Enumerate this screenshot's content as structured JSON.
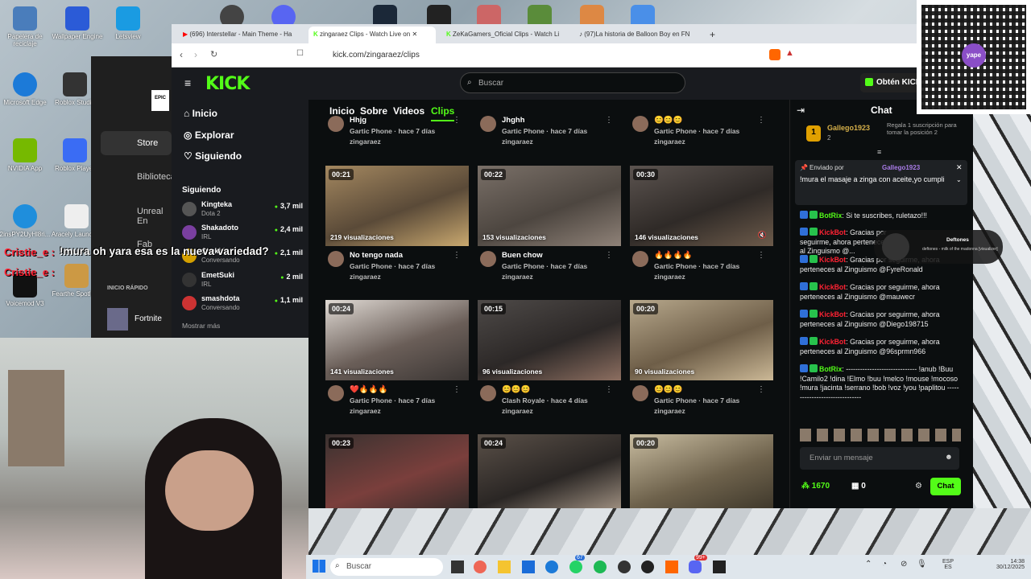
{
  "desktop": {
    "icons": [
      {
        "label": "Papelera de reciclaje",
        "color": "#4a7dbb"
      },
      {
        "label": "Wallpaper Engine",
        "color": "#2b5bd7"
      },
      {
        "label": "Letsview",
        "color": "#1a9be2"
      },
      {
        "label": "Microsoft Edge",
        "color": "#1c7ad8"
      },
      {
        "label": "Roblox Studio",
        "color": "#333"
      },
      {
        "label": "NVIDIA App",
        "color": "#76b900"
      },
      {
        "label": "Roblox Player",
        "color": "#3a6cf4"
      },
      {
        "label": "2insPY2UyHl8ri...",
        "color": "#1f8edc"
      },
      {
        "label": "Aracely Launcher",
        "color": "#eee"
      },
      {
        "label": "Voicemod V3",
        "color": "#111"
      },
      {
        "label": "Fearthe Spotlight",
        "color": "#c94"
      }
    ]
  },
  "overlay": {
    "chat_lines": [
      "Cristie_e :",
      "Cristie_e :"
    ],
    "chat_text": "!mura oh yara esa es la nueva variedad?"
  },
  "epic": {
    "items": [
      "Store",
      "Biblioteca",
      "Unreal En",
      "Fab"
    ],
    "quick": "INICIO RÁPIDO",
    "fortnite": "Fortnite"
  },
  "browser": {
    "tabs": [
      "(696) Interstellar - Main Theme - Ha",
      "zingaraez Clips - Watch Live on",
      "ZeKaGamers_Oficial Clips - Watch Li",
      "(97)La historia de Balloon Boy en FN"
    ],
    "url": "kick.com/zingaraez/clips"
  },
  "kick": {
    "logo": "KICK",
    "search_placeholder": "Buscar",
    "get_kicks": "Obtén KICK",
    "nav": [
      "Inicio",
      "Explorar",
      "Siguiendo"
    ],
    "following_header": "Siguiendo",
    "channels": [
      {
        "name": "Kingteka",
        "game": "Dota 2",
        "viewers": "3,7 mil"
      },
      {
        "name": "Shakadoto",
        "game": "IRL",
        "viewers": "2,4 mil"
      },
      {
        "name": "Shekiti",
        "game": "Conversando",
        "viewers": "2,1 mil"
      },
      {
        "name": "EmetSuki",
        "game": "IRL",
        "viewers": "2 mil"
      },
      {
        "name": "smashdota",
        "game": "Conversando",
        "viewers": "1,1 mil"
      }
    ],
    "show_more": "Mostrar más",
    "channel_tabs": [
      "Inicio",
      "Sobre",
      "Videos",
      "Clips"
    ],
    "top_row": [
      {
        "title": "Hhjg",
        "sub": "Gartic Phone · hace 7 días",
        "user": "zingaraez"
      },
      {
        "title": "Jhghh",
        "sub": "Gartic Phone · hace 7 días",
        "user": "zingaraez"
      },
      {
        "title": "😊😊😊",
        "sub": "Gartic Phone · hace 7 días",
        "user": "zingaraez"
      }
    ],
    "clips": [
      {
        "dur": "00:21",
        "views": "219 visualizaciones",
        "title": "No tengo nada",
        "sub": "Gartic Phone · hace 7 días",
        "user": "zingaraez"
      },
      {
        "dur": "00:22",
        "views": "153 visualizaciones",
        "title": "Buen chow",
        "sub": "Gartic Phone · hace 7 días",
        "user": "zingaraez"
      },
      {
        "dur": "00:30",
        "views": "146 visualizaciones",
        "title": "🔥🔥🔥🔥",
        "sub": "Gartic Phone · hace 7 días",
        "user": "zingaraez"
      },
      {
        "dur": "00:24",
        "views": "141 visualizaciones",
        "title": "❤️🔥🔥🔥",
        "sub": "Gartic Phone · hace 7 días",
        "user": "zingaraez"
      },
      {
        "dur": "00:15",
        "views": "96 visualizaciones",
        "title": "😊😊😊",
        "sub": "Clash Royale · hace 4 días",
        "user": "zingaraez"
      },
      {
        "dur": "00:20",
        "views": "90 visualizaciones",
        "title": "😊😊😊",
        "sub": "Gartic Phone · hace 7 días",
        "user": "zingaraez"
      },
      {
        "dur": "00:23",
        "views": "",
        "title": "",
        "sub": "",
        "user": ""
      },
      {
        "dur": "00:24",
        "views": "",
        "title": "",
        "sub": "",
        "user": ""
      },
      {
        "dur": "00:20",
        "views": "",
        "title": "",
        "sub": "",
        "user": ""
      }
    ],
    "chat": {
      "title": "Chat",
      "gifter": "Gallego1923",
      "gifter_count": "2",
      "gift_text": "Regala 1 suscripción para tomar la posición 2",
      "pinned_by": "Enviado por",
      "pinned_user": "Gallego1923",
      "pinned_msg": "!mura el masaje a zinga con aceite,yo cumpli",
      "messages": [
        {
          "user": "BotRix",
          "text": "Si te suscribes, ruletazo!!!"
        },
        {
          "user": "KickBot",
          "text": "Gracias por seguirme, ahora perteneces al Zinguismo @..."
        },
        {
          "user": "KickBot",
          "text": "Gracias por seguirme, ahora perteneces al Zinguismo @FyreRonald"
        },
        {
          "user": "KickBot",
          "text": "Gracias por seguirme, ahora perteneces al Zinguismo @mauwecr"
        },
        {
          "user": "KickBot",
          "text": "Gracias por seguirme, ahora perteneces al Zinguismo @Diego198715"
        },
        {
          "user": "KickBot",
          "text": "Gracias por seguirme, ahora perteneces al Zinguismo @96sprmn966"
        },
        {
          "user": "BotRix",
          "text": "------------------------------ !anub !Buu !Camilo2 !dina !Elmo !buu !melco !mouse !mocoso !mura !jacinta !serrano !bob !voz !you !paplitou -------------------------------"
        }
      ],
      "input_placeholder": "Enviar un mensaje",
      "points": "1670",
      "gifts": "0",
      "send": "Chat"
    },
    "music": {
      "artist": "Deftones",
      "track": "deftones - milk of the madonna [visualizer]"
    }
  },
  "taskbar": {
    "search": "Buscar",
    "lang": "ESP",
    "region": "ES",
    "time": "14:38",
    "date": "30/12/2025",
    "badges": [
      "67",
      "99+"
    ]
  }
}
